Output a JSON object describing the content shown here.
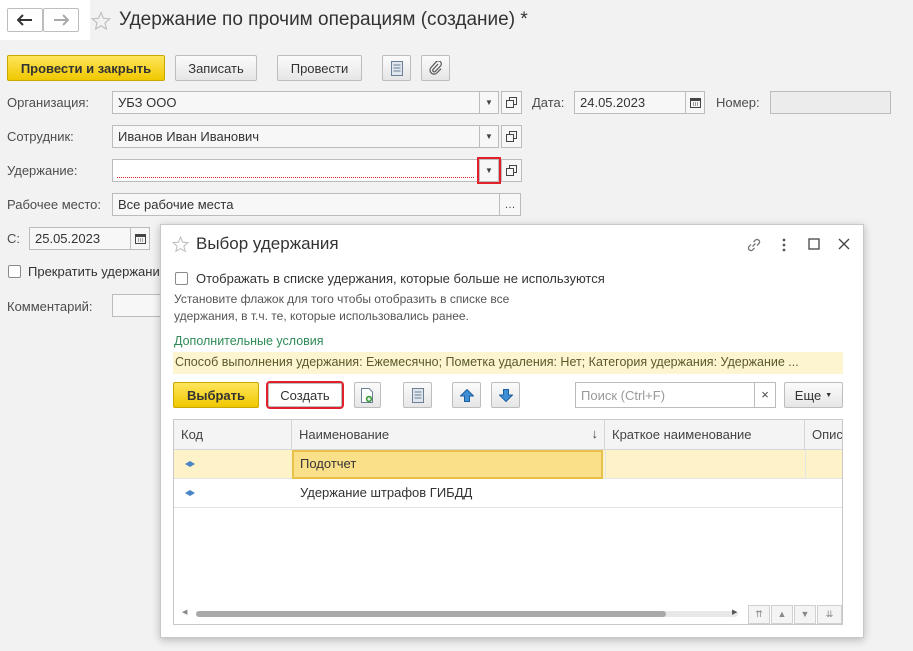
{
  "header": {
    "title": "Удержание по прочим операциям (создание) *"
  },
  "toolbar": {
    "post_close": "Провести и закрыть",
    "save": "Записать",
    "post": "Провести"
  },
  "form": {
    "org_label": "Организация:",
    "org_value": "УБЗ ООО",
    "date_label": "Дата:",
    "date_value": "24.05.2023",
    "number_label": "Номер:",
    "number_value": "",
    "employee_label": "Сотрудник:",
    "employee_value": "Иванов Иван Иванович",
    "deduction_label": "Удержание:",
    "deduction_value": "",
    "workplace_label": "Рабочее место:",
    "workplace_value": "Все рабочие места",
    "from_label": "С:",
    "from_value": "25.05.2023",
    "stop_label": "Прекратить удержани",
    "comment_label": "Комментарий:"
  },
  "dialog": {
    "title": "Выбор удержания",
    "show_unused_label": "Отображать в списке удержания, которые больше не используются",
    "hint_line1": "Установите флажок для того чтобы отобразить в списке все",
    "hint_line2": "удержания, в т.ч. те, которые использовались ранее.",
    "extra_conditions_link": "Дополнительные условия",
    "filter_text": "Способ выполнения удержания: Ежемесячно; Пометка удаления: Нет; Категория удержания: Удержание ...",
    "select_button": "Выбрать",
    "create_button": "Создать",
    "search_placeholder": "Поиск (Ctrl+F)",
    "search_clear": "×",
    "more_button": "Еще",
    "columns": {
      "code": "Код",
      "name": "Наименование",
      "sort_indicator": "↓",
      "short_name": "Краткое наименование",
      "description": "Опис"
    },
    "rows": [
      {
        "code": "",
        "name": "Подотчет",
        "short_name": ""
      },
      {
        "code": "",
        "name": "Удержание штрафов ГИБДД",
        "short_name": ""
      }
    ]
  },
  "colors": {
    "accent_yellow": "#f5d20f",
    "highlight_row": "#fdf2c8",
    "link_green": "#2e8b57",
    "red_frame": "#e0202a",
    "filter_bg": "#fdf5cf"
  },
  "icons": [
    "back-arrow-icon",
    "forward-arrow-icon",
    "star-icon",
    "list-icon",
    "paperclip-icon",
    "calendar-icon",
    "open-icon",
    "link-icon",
    "more-vertical-icon",
    "maximize-icon",
    "close-icon",
    "copy-icon",
    "move-up-icon",
    "move-down-icon"
  ]
}
